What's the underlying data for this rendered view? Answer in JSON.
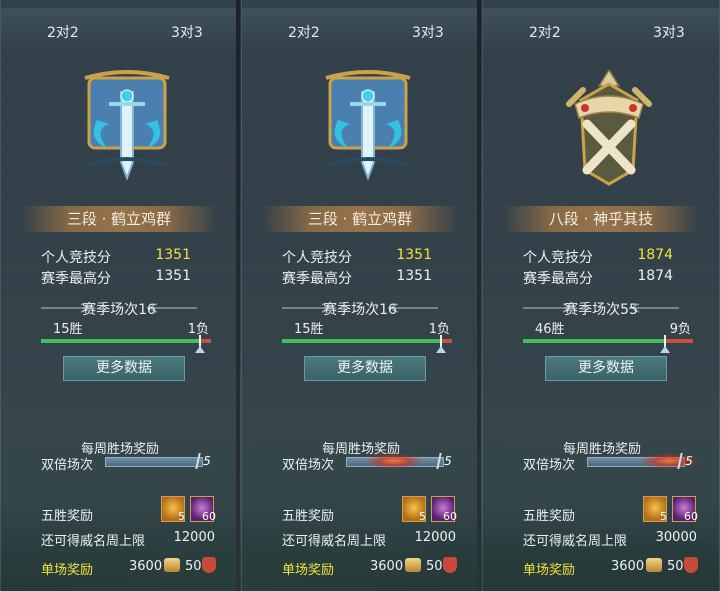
{
  "panels": [
    {
      "tabs": [
        "2对2",
        "3对3"
      ],
      "emblem": "sword-banner-emblem",
      "rank": "三段 · 鹤立鸡群",
      "personal_label": "个人竞技分",
      "personal_value": "1351",
      "season_best_label": "赛季最高分",
      "season_best_value": "1351",
      "season_matches": "赛季场次16",
      "wins": "15胜",
      "losses": "1负",
      "win_fraction": 0.9375,
      "more_data": "更多数据",
      "weekly_reward": "每周胜场奖励",
      "double_label": "双倍场次",
      "double_count": "5",
      "double_progress": 0,
      "five_win_reward": "五胜奖励",
      "item1_count": "5",
      "item2_count": "60",
      "limit_label": "还可得威名周上限",
      "limit_value": "12000",
      "single_reward": "单场奖励",
      "single_coin": "3600",
      "single_honor": "50"
    },
    {
      "tabs": [
        "2对2",
        "3对3"
      ],
      "emblem": "sword-banner-emblem",
      "rank": "三段 · 鹤立鸡群",
      "personal_label": "个人竞技分",
      "personal_value": "1351",
      "season_best_label": "赛季最高分",
      "season_best_value": "1351",
      "season_matches": "赛季场次16",
      "wins": "15胜",
      "losses": "1负",
      "win_fraction": 0.9375,
      "more_data": "更多数据",
      "weekly_reward": "每周胜场奖励",
      "double_label": "双倍场次",
      "double_count": "5",
      "double_progress": 0.5,
      "five_win_reward": "五胜奖励",
      "item1_count": "5",
      "item2_count": "60",
      "limit_label": "还可得威名周上限",
      "limit_value": "12000",
      "single_reward": "单场奖励",
      "single_coin": "3600",
      "single_honor": "50"
    },
    {
      "tabs": [
        "2对2",
        "3对3"
      ],
      "emblem": "crossed-swords-crown-emblem",
      "rank": "八段 · 神乎其技",
      "personal_label": "个人竞技分",
      "personal_value": "1874",
      "season_best_label": "赛季最高分",
      "season_best_value": "1874",
      "season_matches": "赛季场次55",
      "wins": "46胜",
      "losses": "9负",
      "win_fraction": 0.836,
      "more_data": "更多数据",
      "weekly_reward": "每周胜场奖励",
      "double_label": "双倍场次",
      "double_count": "5",
      "double_progress": 0.85,
      "five_win_reward": "五胜奖励",
      "item1_count": "5",
      "item2_count": "60",
      "limit_label": "还可得威名周上限",
      "limit_value": "30000",
      "single_reward": "单场奖励",
      "single_coin": "3600",
      "single_honor": "50"
    }
  ],
  "colors": {
    "highlight": "#f2e23a",
    "win_bar": "#3dc25a",
    "loss_bar": "#c9513b",
    "button": "#3b6368"
  }
}
